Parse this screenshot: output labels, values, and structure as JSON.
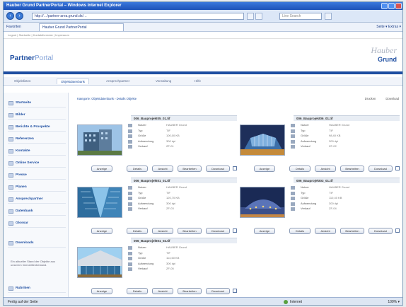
{
  "browser": {
    "title": "Hauber Grund PartnerPortal – Windows Internet Explorer",
    "url": "http://…/partner-area.grund.de/…",
    "search_placeholder": "Live Search",
    "favorites_label": "Favoriten",
    "tab_label": "Hauber Grund PartnerPortal",
    "tools_label": "Seite ▾  Extras ▾",
    "status_left": "Fertig auf der Seite",
    "status_zone": "Internet",
    "status_zoom": "100% ▾"
  },
  "top_crumbs": "Logout  |  Startseite  |  Kontaktformular  |  Impressum",
  "header": {
    "logo_bold": "Partner",
    "logo_light": "Portal",
    "brand_line1": "Hauber",
    "brand_line2": "Grund"
  },
  "tabs": [
    "Objektlisten",
    "Objektdatenbank",
    "Ansprechpartner",
    "Verwaltung",
    "Hilfe"
  ],
  "sidebar": {
    "items": [
      "Startseite",
      "Bilder",
      "Berichte & Prospekte",
      "Referenzen",
      "Kontakte",
      "Online Service",
      "Presse",
      "Planen",
      "Ansprechpartner",
      "Datenbank",
      "Glossar",
      "Downloads"
    ],
    "box_text": "Ein aktueller Stand der Objekte aus unserem Immobilienbestand.",
    "footer_item": "Rubriken"
  },
  "main": {
    "breadcrumb": "Kategorie: Objektdatenbank  ›  Details Objekte",
    "link_print": "Drucken",
    "link_download": "Download"
  },
  "meta_labels": [
    "Nutzer",
    "Typ",
    "Größe",
    "Aufwendung",
    "Verkauf"
  ],
  "cards": [
    {
      "title": "006_Bauprojekt05_01.tif",
      "values": [
        "HAUBER Grund",
        "TIF",
        "100,00 KB",
        "300 dpi",
        "ZF-01"
      ]
    },
    {
      "title": "006_Bauprojekt06_01.tif",
      "values": [
        "HAUBER Grund",
        "TIF",
        "98,40 KB",
        "300 dpi",
        "ZF-02"
      ]
    },
    {
      "title": "006_Bauprojekt01_01.tif",
      "values": [
        "HAUBER Grund",
        "TIF",
        "120,70 KB",
        "300 dpi",
        "ZF-03"
      ]
    },
    {
      "title": "006_Bauprojekt03_01.tif",
      "values": [
        "HAUBER Grund",
        "TIF",
        "110,40 KB",
        "300 dpi",
        "ZF-04"
      ]
    },
    {
      "title": "006_Bauprojekt01_02.tif",
      "values": [
        "HAUBER Grund",
        "TIF",
        "114,60 KB",
        "300 dpi",
        "ZF-05"
      ]
    }
  ],
  "card_buttons": [
    "Anzeige",
    "Details",
    "Ansicht",
    "Bearbeiten",
    "Download"
  ],
  "colors": {
    "accent": "#1e4ea1",
    "titlebar": "#2a64c8"
  }
}
